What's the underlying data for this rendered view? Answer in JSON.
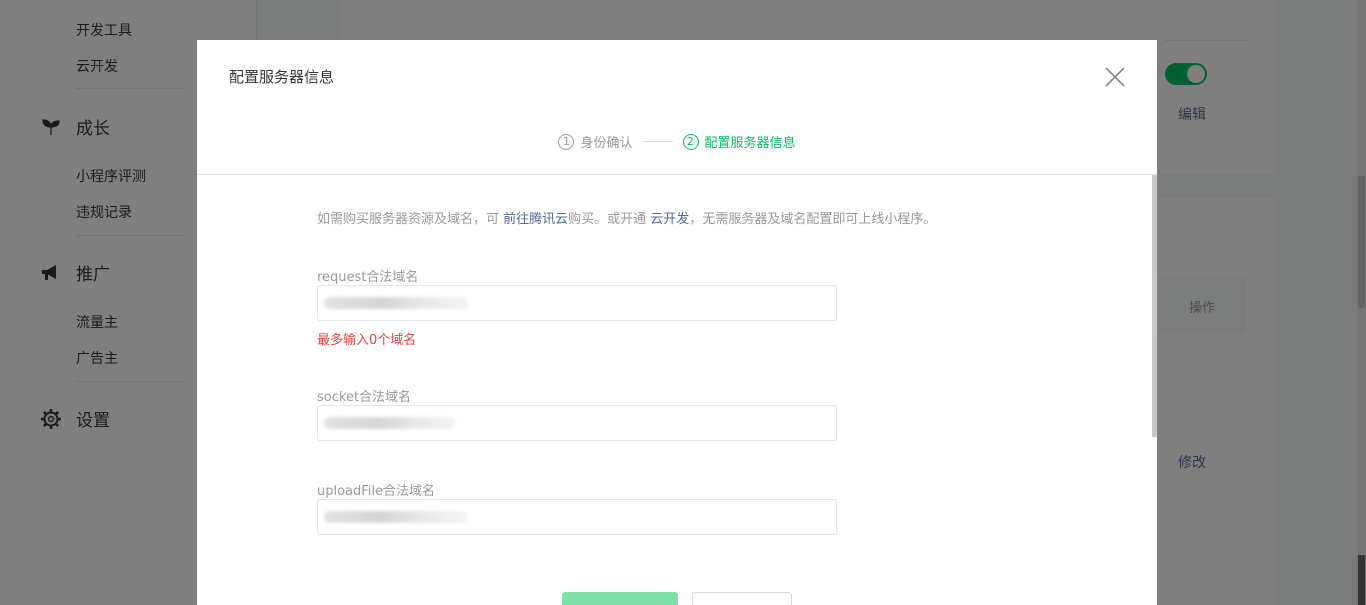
{
  "sidebar": {
    "items": [
      {
        "label": "开发工具",
        "type": "sub"
      },
      {
        "label": "云开发",
        "type": "sub"
      },
      {
        "label": "成长",
        "type": "group",
        "icon": "sprout-icon"
      },
      {
        "label": "小程序评测",
        "type": "sub"
      },
      {
        "label": "违规记录",
        "type": "sub"
      },
      {
        "label": "推广",
        "type": "group",
        "icon": "megaphone-icon"
      },
      {
        "label": "流量主",
        "type": "sub"
      },
      {
        "label": "广告主",
        "type": "sub"
      },
      {
        "label": "设置",
        "type": "group",
        "icon": "gear-icon"
      }
    ]
  },
  "background": {
    "edit_link": "编辑",
    "table_header_action": "操作",
    "modify_link": "修改",
    "accent_color": "#07c160"
  },
  "modal": {
    "title": "配置服务器信息",
    "steps": [
      {
        "num": "1",
        "label": "身份确认",
        "state": "done"
      },
      {
        "num": "2",
        "label": "配置服务器信息",
        "state": "active"
      }
    ],
    "notice": {
      "prefix": "如需购买服务器资源及域名，可 ",
      "link1": "前往腾讯云",
      "middle": "购买。或开通 ",
      "link2": "云开发",
      "suffix": "，无需服务器及域名配置即可上线小程序。"
    },
    "fields": [
      {
        "label": "request合法域名",
        "value": "",
        "error": "最多输入0个域名"
      },
      {
        "label": "socket合法域名",
        "value": ""
      },
      {
        "label": "uploadFile合法域名",
        "value": ""
      }
    ],
    "colors": {
      "link": "#576b95",
      "error": "#e64340",
      "primary": "#07c160"
    }
  }
}
